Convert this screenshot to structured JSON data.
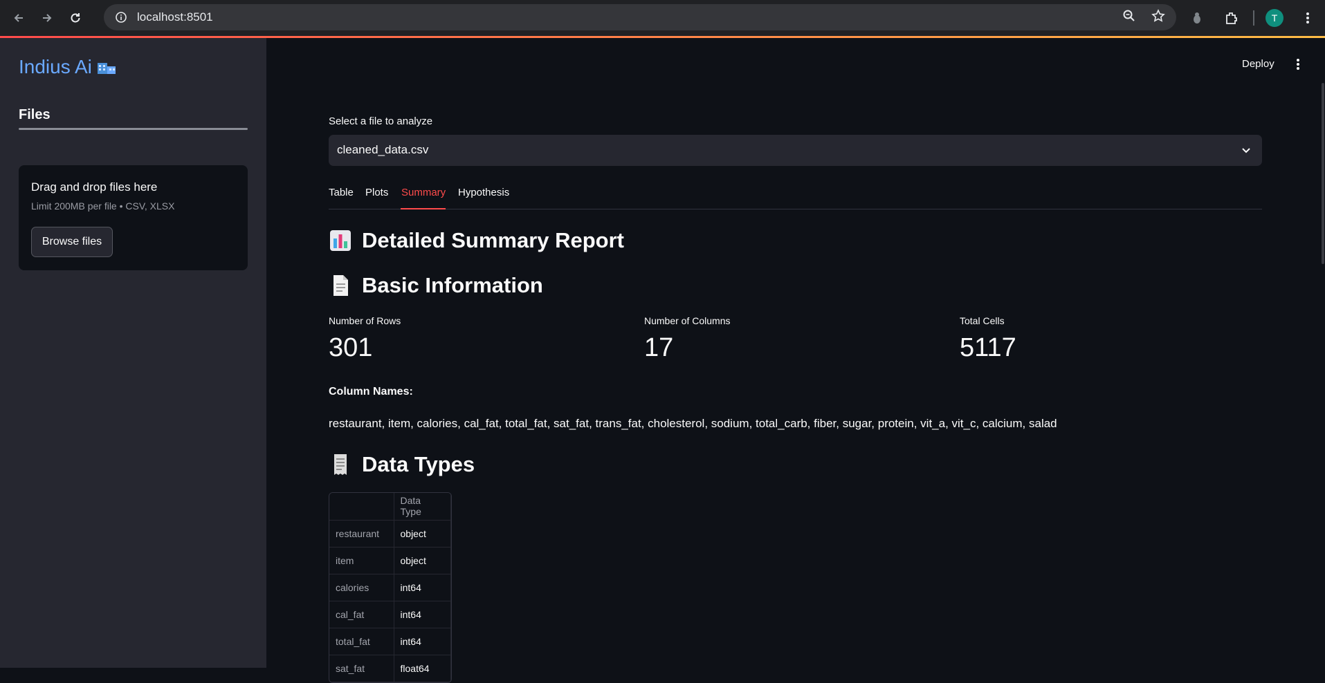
{
  "browser": {
    "url": "localhost:8501",
    "avatar_letter": "T"
  },
  "sidebar": {
    "brand": "Indius Ai",
    "files_tab": "Files",
    "dropzone": {
      "title": "Drag and drop files here",
      "limit": "Limit 200MB per file • CSV, XLSX",
      "browse_label": "Browse files"
    }
  },
  "header": {
    "deploy_label": "Deploy"
  },
  "main": {
    "select_label": "Select a file to analyze",
    "select_value": "cleaned_data.csv",
    "tabs": [
      {
        "label": "Table"
      },
      {
        "label": "Plots"
      },
      {
        "label": "Summary"
      },
      {
        "label": "Hypothesis"
      }
    ],
    "active_tab": "Summary",
    "report_title": "Detailed Summary Report",
    "basic_info_title": "Basic Information",
    "metrics": [
      {
        "label": "Number of Rows",
        "value": "301"
      },
      {
        "label": "Number of Columns",
        "value": "17"
      },
      {
        "label": "Total Cells",
        "value": "5117"
      }
    ],
    "column_names_title": "Column Names:",
    "column_names": "restaurant, item, calories, cal_fat, total_fat, sat_fat, trans_fat, cholesterol, sodium, total_carb, fiber, sugar, protein, vit_a, vit_c, calcium, salad",
    "data_types_title": "Data Types",
    "dtype_header": "Data Type",
    "dtypes": [
      {
        "column": "restaurant",
        "type": "object"
      },
      {
        "column": "item",
        "type": "object"
      },
      {
        "column": "calories",
        "type": "int64"
      },
      {
        "column": "cal_fat",
        "type": "int64"
      },
      {
        "column": "total_fat",
        "type": "int64"
      },
      {
        "column": "sat_fat",
        "type": "float64"
      }
    ]
  },
  "colors": {
    "accent": "#ff4b4b",
    "brand": "#6aa9ff",
    "background": "#0e1117",
    "sidebar": "#262730"
  }
}
